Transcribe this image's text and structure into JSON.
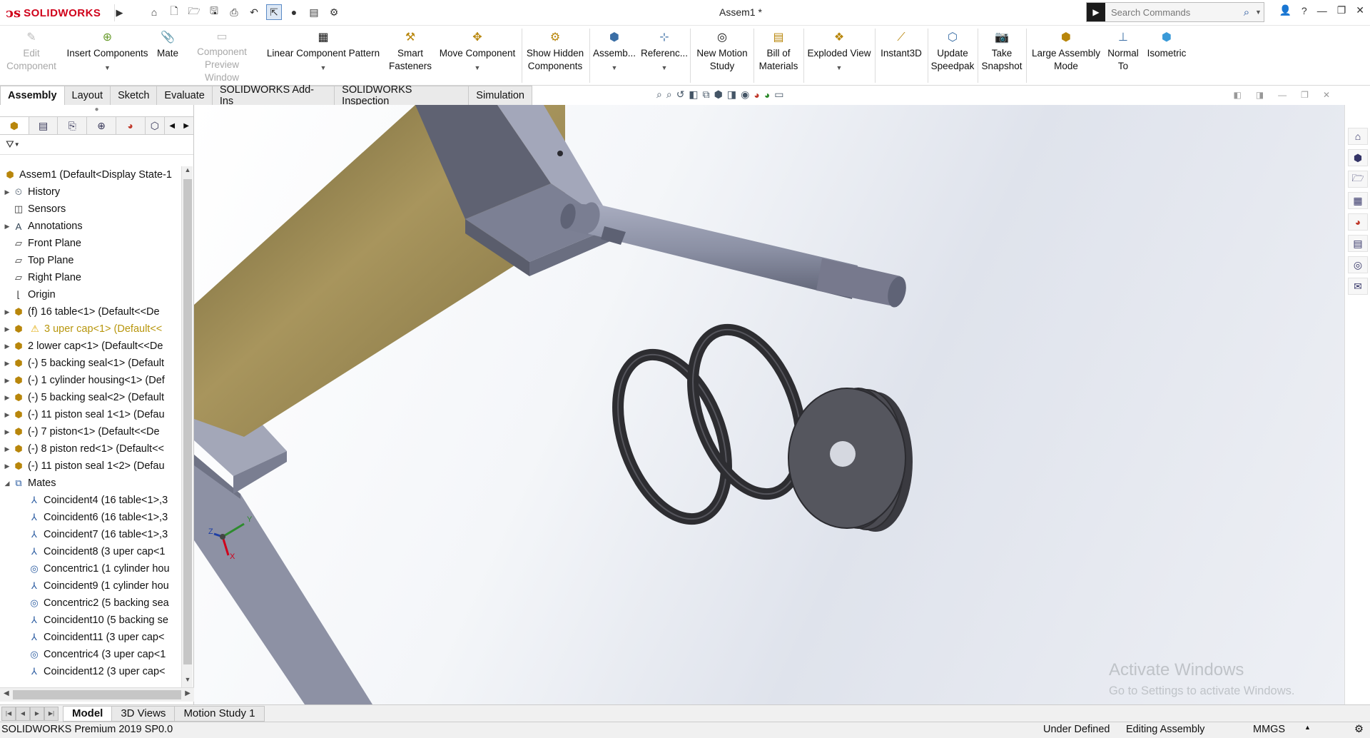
{
  "app": {
    "brand": "SOLIDWORKS",
    "document_title": "Assem1 *",
    "search_placeholder": "Search Commands"
  },
  "command_manager": {
    "edit_component": "Edit Component",
    "insert_components": "Insert Components",
    "mate": "Mate",
    "component_preview": "Component Preview Window",
    "linear_pattern": "Linear Component Pattern",
    "smart_fasteners": "Smart Fasteners",
    "move_component": "Move Component",
    "show_hidden": "Show Hidden Components",
    "assembly_features": "Assemb...",
    "reference_geometry": "Referenc...",
    "new_motion_study": "New Motion Study",
    "bill_of_materials": "Bill of Materials",
    "exploded_view": "Exploded View",
    "instant3d": "Instant3D",
    "update_speedpak": "Update Speedpak",
    "take_snapshot": "Take Snapshot",
    "large_assembly_mode": "Large Assembly Mode",
    "normal_to": "Normal To",
    "isometric": "Isometric"
  },
  "tabs": [
    "Assembly",
    "Layout",
    "Sketch",
    "Evaluate",
    "SOLIDWORKS Add-Ins",
    "SOLIDWORKS Inspection",
    "Simulation"
  ],
  "feature_tree": {
    "root": "Assem1  (Default<Display State-1",
    "items": [
      {
        "label": "History",
        "icon": "history-icon"
      },
      {
        "label": "Sensors",
        "icon": "sensors-icon"
      },
      {
        "label": "Annotations",
        "icon": "annotations-icon"
      },
      {
        "label": "Front Plane",
        "icon": "plane-icon"
      },
      {
        "label": "Top Plane",
        "icon": "plane-icon"
      },
      {
        "label": "Right Plane",
        "icon": "plane-icon"
      },
      {
        "label": "Origin",
        "icon": "origin-icon"
      },
      {
        "label": "(f) 16 table<1> (Default<<De",
        "icon": "part-icon"
      },
      {
        "label": "3 uper cap<1> (Default<<",
        "icon": "part-icon",
        "warning": true
      },
      {
        "label": "2 lower cap<1> (Default<<De",
        "icon": "part-icon"
      },
      {
        "label": "(-) 5 backing seal<1> (Default",
        "icon": "part-icon"
      },
      {
        "label": "(-) 1 cylinder housing<1> (Def",
        "icon": "part-icon"
      },
      {
        "label": "(-) 5 backing seal<2> (Default",
        "icon": "part-icon"
      },
      {
        "label": "(-) 11 piston seal 1<1> (Defau",
        "icon": "part-icon"
      },
      {
        "label": "(-) 7 piston<1> (Default<<De",
        "icon": "part-icon"
      },
      {
        "label": "(-) 8 piston red<1> (Default<<",
        "icon": "part-icon"
      },
      {
        "label": "(-) 11 piston seal 1<2> (Defau",
        "icon": "part-icon"
      },
      {
        "label": "Mates",
        "icon": "mates-icon"
      }
    ],
    "mates": [
      {
        "label": "Coincident4 (16 table<1>,3",
        "icon": "coincident-icon"
      },
      {
        "label": "Coincident6 (16 table<1>,3",
        "icon": "coincident-icon"
      },
      {
        "label": "Coincident7 (16 table<1>,3",
        "icon": "coincident-icon"
      },
      {
        "label": "Coincident8 (3 uper cap<1",
        "icon": "coincident-icon"
      },
      {
        "label": "Concentric1 (1 cylinder hou",
        "icon": "concentric-icon"
      },
      {
        "label": "Coincident9 (1 cylinder hou",
        "icon": "coincident-icon"
      },
      {
        "label": "Concentric2 (5 backing sea",
        "icon": "concentric-icon"
      },
      {
        "label": "Coincident10 (5 backing se",
        "icon": "coincident-icon"
      },
      {
        "label": "Coincident11 (3 uper cap<",
        "icon": "coincident-icon"
      },
      {
        "label": "Concentric4 (3 uper cap<1",
        "icon": "concentric-icon"
      },
      {
        "label": "Coincident12 (3 uper cap<",
        "icon": "coincident-icon"
      }
    ]
  },
  "triad": {
    "x": "X",
    "y": "Y",
    "z": "Z"
  },
  "watermark": {
    "line1": "Activate Windows",
    "line2": "Go to Settings to activate Windows."
  },
  "bottom_tabs": [
    "Model",
    "3D Views",
    "Motion Study 1"
  ],
  "status": {
    "product": "SOLIDWORKS Premium 2019 SP0.0",
    "state": "Under Defined",
    "mode": "Editing Assembly",
    "units": "MMGS"
  },
  "colors": {
    "brand_red": "#d0021b",
    "cylinder_gold": "#9c8a52",
    "frame_gray": "#9499ad",
    "seal_dark": "#3a3a3e"
  }
}
